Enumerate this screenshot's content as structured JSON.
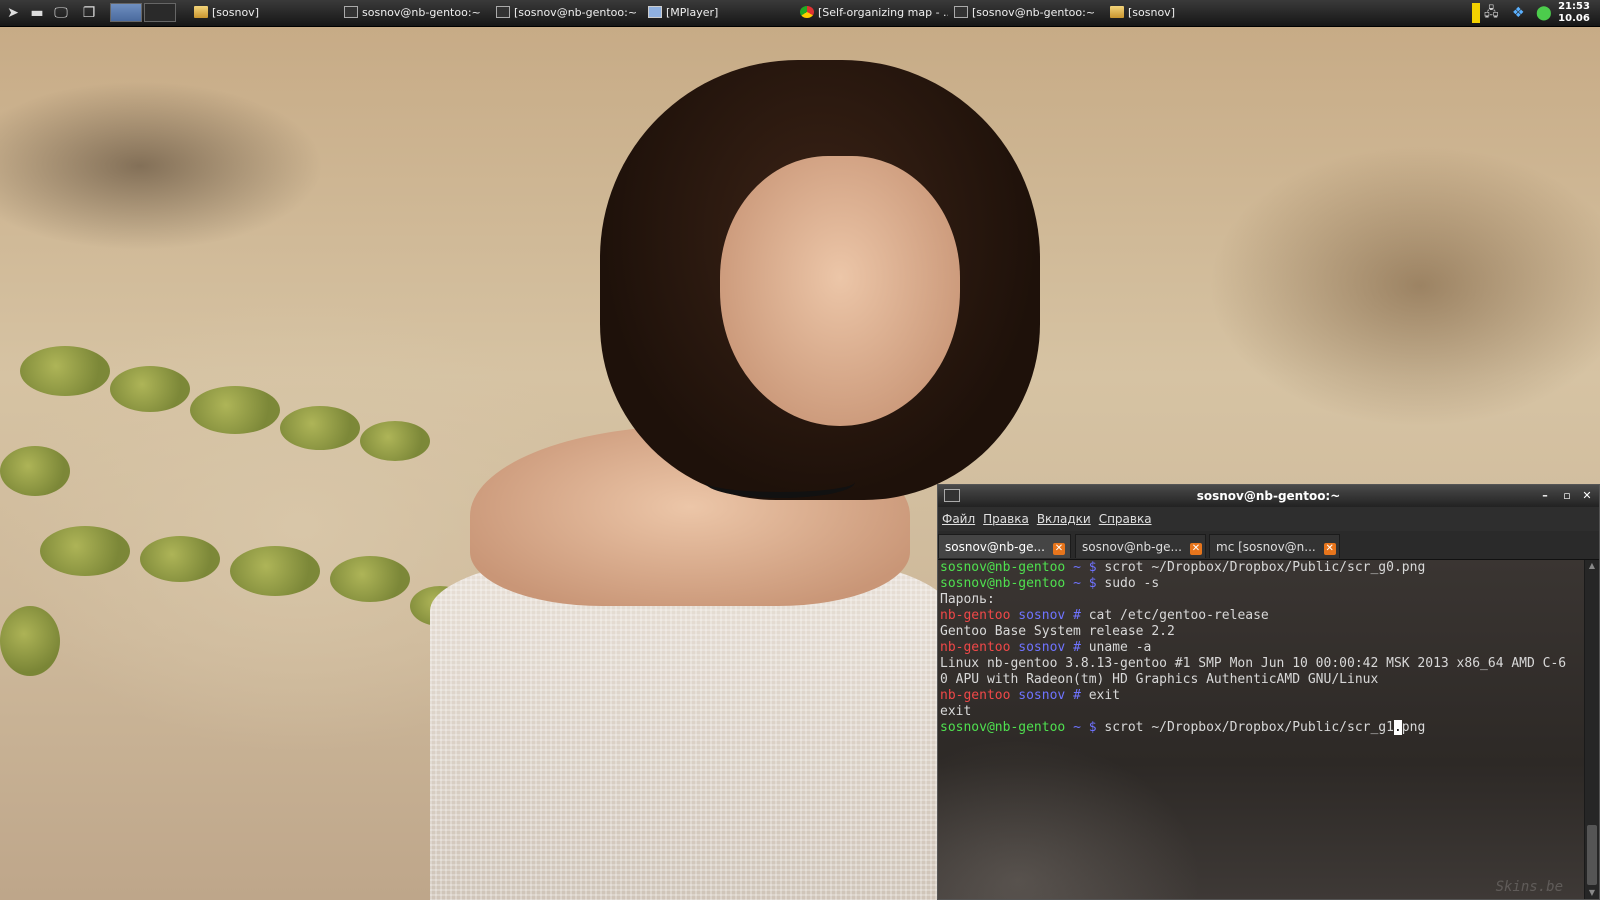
{
  "taskbar": {
    "tasks": [
      {
        "label": "[sosnov]",
        "icon": "folder-icon"
      },
      {
        "label": "sosnov@nb-gentoo:~",
        "icon": "terminal-icon"
      },
      {
        "label": "[sosnov@nb-gentoo:~]",
        "icon": "terminal-icon"
      },
      {
        "label": "[MPlayer]",
        "icon": "window-icon"
      },
      {
        "label": "[Self-organizing map - ...",
        "icon": "chrome-icon"
      },
      {
        "label": "[sosnov@nb-gentoo:~]",
        "icon": "terminal-icon"
      },
      {
        "label": "[sosnov]",
        "icon": "folder-icon"
      }
    ],
    "clock": {
      "time": "21:53",
      "date": "10.06"
    }
  },
  "terminal": {
    "title": "sosnov@nb-gentoo:~",
    "menu": [
      "Файл",
      "Правка",
      "Вкладки",
      "Справка"
    ],
    "tabs": [
      "sosnov@nb-ge...",
      "sosnov@nb-ge...",
      "mc [sosnov@n..."
    ],
    "tab_close": "✕",
    "lines": [
      {
        "user": "sosnov@nb-gentoo",
        "tilde": "~",
        "sym": "$",
        "cmd": "scrot ~/Dropbox/Dropbox/Public/scr_g0.png"
      },
      {
        "user": "sosnov@nb-gentoo",
        "tilde": "~",
        "sym": "$",
        "cmd": "sudo -s"
      },
      {
        "text": "Пароль:"
      },
      {
        "host": "nb-gentoo",
        "dir": "sosnov",
        "sym": "#",
        "cmd": "cat /etc/gentoo-release"
      },
      {
        "text": "Gentoo Base System release 2.2"
      },
      {
        "host": "nb-gentoo",
        "dir": "sosnov",
        "sym": "#",
        "cmd": "uname -a"
      },
      {
        "text": "Linux nb-gentoo 3.8.13-gentoo #1 SMP Mon Jun 10 00:00:42 MSK 2013 x86_64 AMD C-6"
      },
      {
        "text": "0 APU with Radeon(tm) HD Graphics AuthenticAMD GNU/Linux"
      },
      {
        "host": "nb-gentoo",
        "dir": "sosnov",
        "sym": "#",
        "cmd": "exit"
      },
      {
        "text": "exit"
      },
      {
        "user": "sosnov@nb-gentoo",
        "tilde": "~",
        "sym": "$",
        "cmd_before": "scrot ~/Dropbox/Dropbox/Public/scr_g1",
        "cursor": ".",
        "cmd_after": "png"
      }
    ],
    "watermark": "Skins.be"
  },
  "colors": {
    "user": "#4fe04f",
    "root": "#f04848",
    "path": "#6f73ff",
    "tab_close": "#e7751c"
  }
}
